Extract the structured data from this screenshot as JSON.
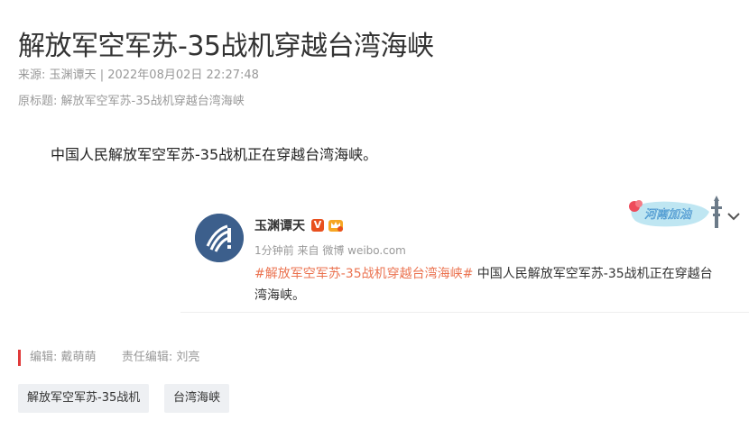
{
  "article": {
    "title": "解放军空军苏-35战机穿越台湾海峡",
    "source_label": "来源:",
    "source_name": "玉渊谭天",
    "separator": "|",
    "datetime": "2022年08月02日 22:27:48",
    "original_title_label": "原标题:",
    "original_title": "解放军空军苏-35战机穿越台湾海峡",
    "body": "中国人民解放军空军苏-35战机正在穿越台湾海峡。"
  },
  "weibo_card": {
    "author": "玉渊谭天",
    "verified_badge": "V",
    "time": "1分钟前",
    "from_label": "来自",
    "from_value": "微博 weibo.com",
    "topic": "#解放军空军苏-35战机穿越台湾海峡#",
    "text": " 中国人民解放军空军苏-35战机正在穿越台湾海峡。",
    "sticker_text": "河南加油",
    "avatar_icon": "avatar-icon",
    "expand_icon": "chevron-down-icon"
  },
  "footer": {
    "editor_label": "编辑:",
    "editor": "戴萌萌",
    "chief_editor_label": "责任编辑:",
    "chief_editor": "刘亮",
    "tags": [
      "解放军空军苏-35战机",
      "台湾海峡"
    ]
  },
  "colors": {
    "topic": "#eb7350",
    "editor_bar": "#e03a3a",
    "tag_bg": "#eef0f3",
    "avatar_bg": "#3c5f8c"
  }
}
